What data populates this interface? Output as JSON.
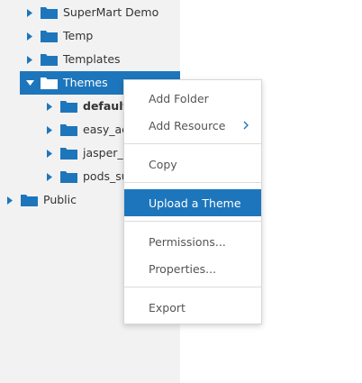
{
  "tree": {
    "nodes": [
      {
        "name": "tree-node-supermart-demo",
        "label": "SuperMart Demo"
      },
      {
        "name": "tree-node-temp",
        "label": "Temp"
      },
      {
        "name": "tree-node-templates",
        "label": "Templates"
      },
      {
        "name": "tree-node-themes",
        "label": "Themes",
        "expanded": true,
        "selected": true
      },
      {
        "name": "tree-node-default",
        "label": "default"
      },
      {
        "name": "tree-node-easy-access",
        "label": "easy_acc"
      },
      {
        "name": "tree-node-jasper-dark",
        "label": "jasper_da"
      },
      {
        "name": "tree-node-pods-summer",
        "label": "pods_sun"
      },
      {
        "name": "tree-node-public",
        "label": "Public"
      }
    ]
  },
  "context_menu": {
    "add_folder": "Add Folder",
    "add_resource": "Add Resource",
    "copy": "Copy",
    "upload_theme": "Upload a Theme",
    "permissions": "Permissions...",
    "properties": "Properties...",
    "export": "Export"
  },
  "colors": {
    "accent": "#1d76bc",
    "folder": "#1d76bc",
    "tree_background": "#f2f2f2"
  }
}
